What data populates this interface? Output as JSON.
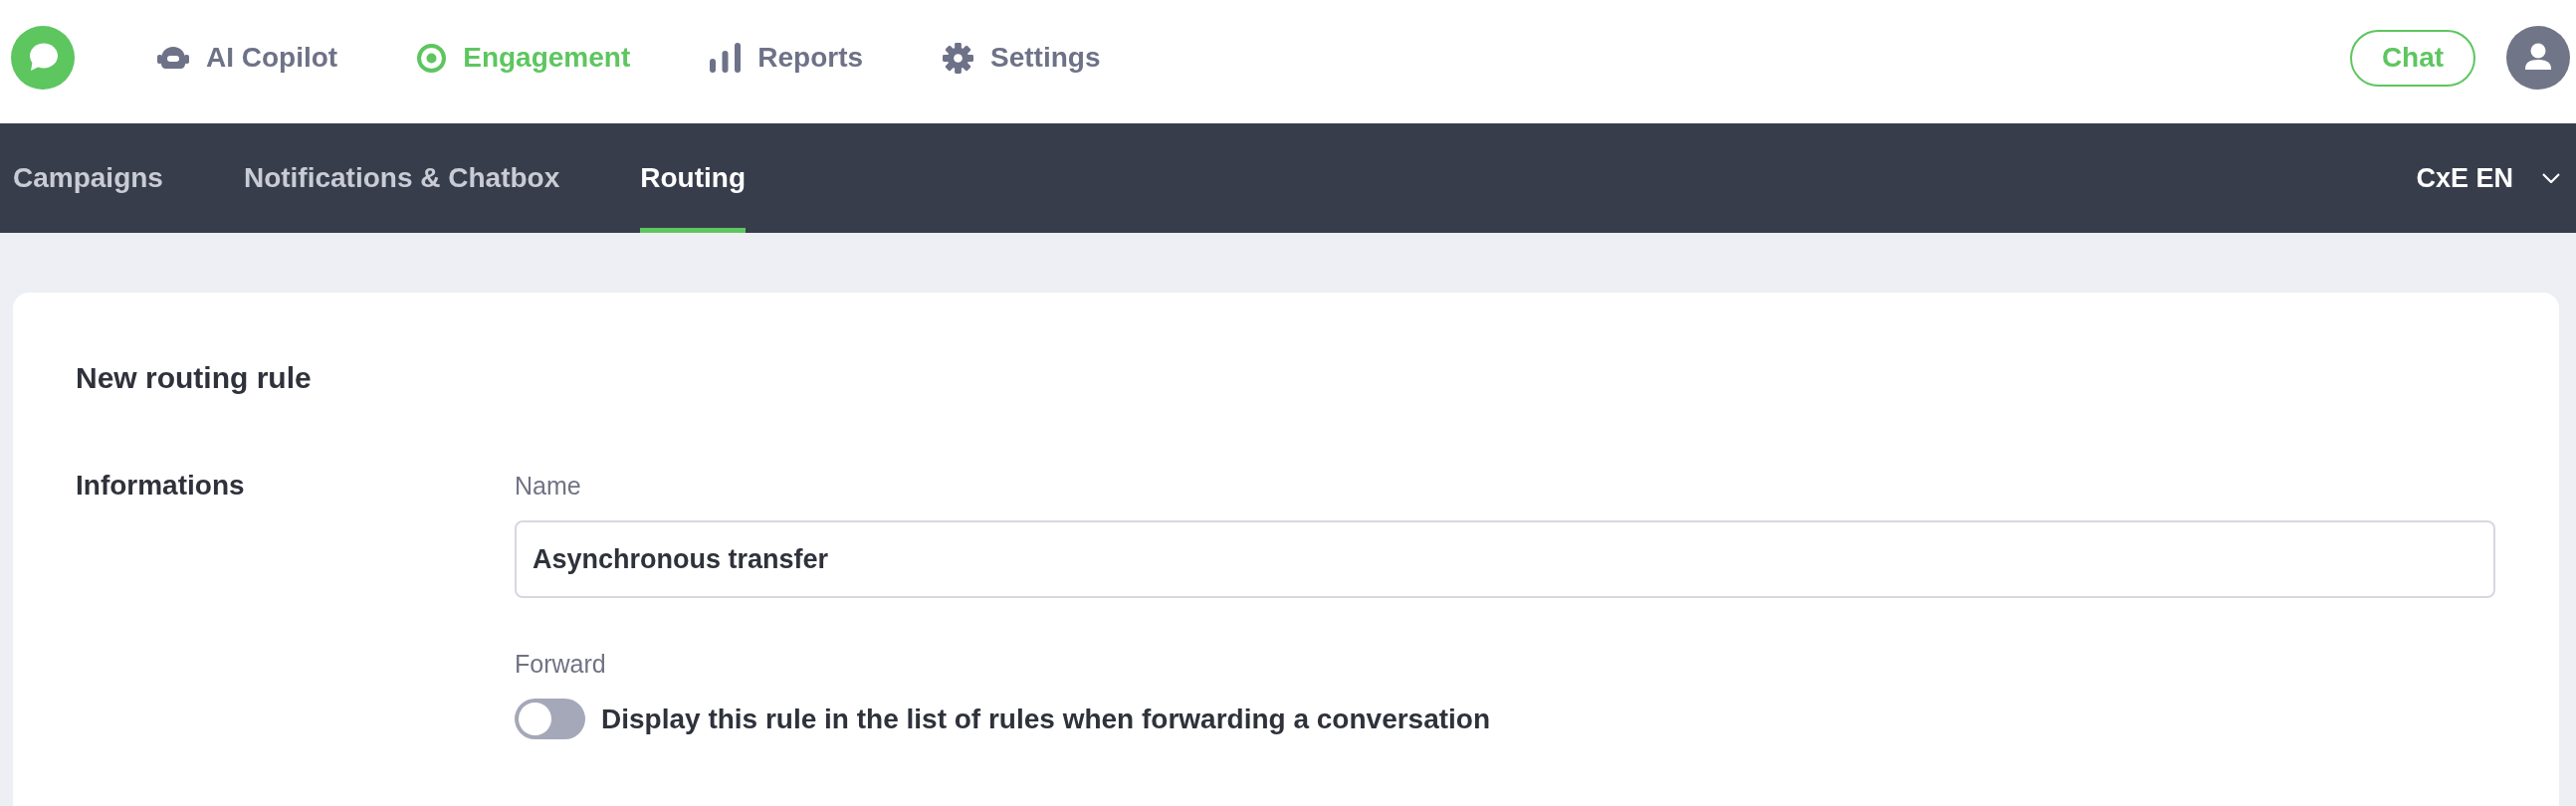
{
  "top_nav": {
    "items": [
      {
        "label": "AI Copilot",
        "selected": false
      },
      {
        "label": "Engagement",
        "selected": true
      },
      {
        "label": "Reports",
        "selected": false
      },
      {
        "label": "Settings",
        "selected": false
      }
    ],
    "chat_button": "Chat"
  },
  "sub_nav": {
    "tabs": [
      {
        "label": "Campaigns",
        "selected": false
      },
      {
        "label": "Notifications & Chatbox",
        "selected": false
      },
      {
        "label": "Routing",
        "selected": true
      }
    ],
    "account": "CxE EN"
  },
  "form": {
    "title": "New routing rule",
    "sections": [
      {
        "title": "Informations",
        "fields": [
          {
            "kind": "text",
            "label": "Name",
            "value": "Asynchronous transfer"
          },
          {
            "kind": "toggle",
            "label": "Forward",
            "on": false,
            "text": "Display this rule in the list of rules when forwarding a conversation"
          }
        ]
      }
    ]
  }
}
